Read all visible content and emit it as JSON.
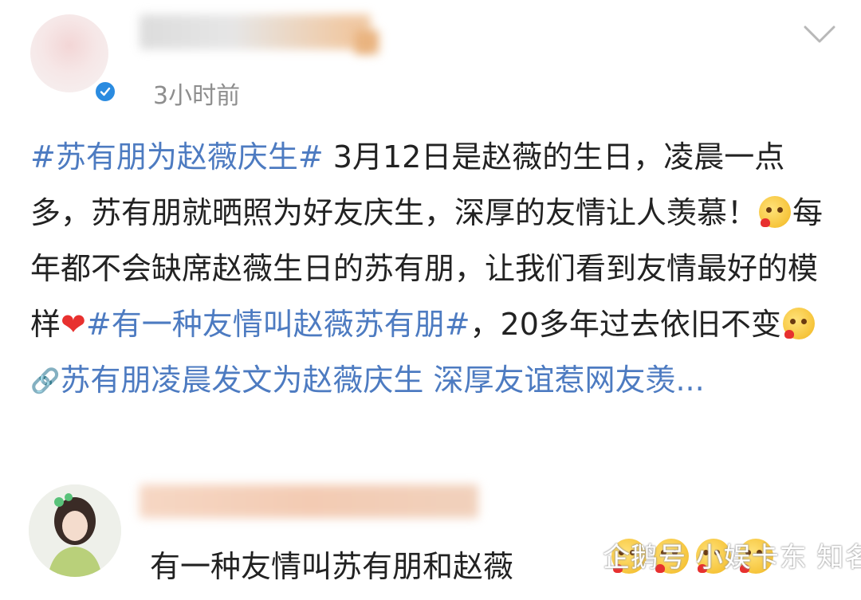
{
  "post": {
    "time": "3小时前",
    "segments": [
      {
        "type": "tag",
        "text": "#苏有朋为赵薇庆生#"
      },
      {
        "type": "text",
        "text": " 3月12日是赵薇的生日，凌晨一点多，苏有朋就晒照为好友庆生，深厚的友情让人羡慕！"
      },
      {
        "type": "emoji",
        "name": "emoji-face-heart"
      },
      {
        "type": "text",
        "text": "每年都不会缺席赵薇生日的苏有朋，让我们看到友情最好的模样"
      },
      {
        "type": "heart"
      },
      {
        "type": "tag",
        "text": "#有一种友情叫赵薇苏有朋#"
      },
      {
        "type": "text",
        "text": "，20多年过去依旧不变"
      },
      {
        "type": "emoji",
        "name": "emoji-face-heart"
      },
      {
        "type": "link-icon",
        "icon": "link-icon"
      },
      {
        "type": "link",
        "text": "苏有朋凌晨发文为赵薇庆生 深厚友谊惹网友羡..."
      }
    ]
  },
  "comment": {
    "text": "有一种友情叫苏有朋和赵薇"
  },
  "watermark": {
    "text": "企鹅号 小娱卡东  知名东"
  },
  "colors": {
    "tag": "#4d7bc1",
    "verify": "#2a8be0",
    "time": "#8e8e8e",
    "heart": "#e8312f"
  }
}
